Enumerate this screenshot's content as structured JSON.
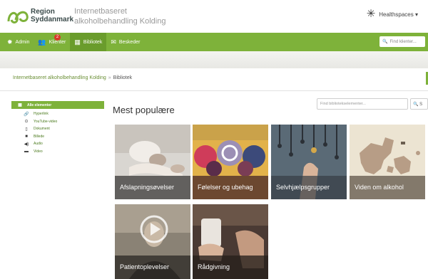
{
  "header": {
    "logo_line1": "Region",
    "logo_line2": "Syddanmark",
    "title_line1": "Internetbaseret",
    "title_line2": "alkoholbehandling Kolding",
    "user_menu": "Healthspaces ▾"
  },
  "nav": {
    "items": [
      {
        "label": "Admin",
        "icon": "gear-icon"
      },
      {
        "label": "Klienter",
        "icon": "users-icon",
        "badge": "2"
      },
      {
        "label": "Bibliotek",
        "icon": "grid-icon"
      },
      {
        "label": "Beskeder",
        "icon": "envelope-icon"
      }
    ],
    "search_placeholder": "Find klienter..."
  },
  "breadcrumb": {
    "root": "Internetbaseret alkoholbehandling Kolding",
    "separator": "»",
    "current": "Bibliotek"
  },
  "sidebar": {
    "items": [
      {
        "label": "Alle elementer",
        "icon": "grid-icon"
      },
      {
        "label": "Hyperlink",
        "icon": "link-icon"
      },
      {
        "label": "YouTube-video",
        "icon": "play-icon"
      },
      {
        "label": "Dokument",
        "icon": "document-icon"
      },
      {
        "label": "Billede",
        "icon": "camera-icon"
      },
      {
        "label": "Audio",
        "icon": "speaker-icon"
      },
      {
        "label": "Video",
        "icon": "video-icon"
      }
    ]
  },
  "main": {
    "heading": "Mest populære",
    "search_placeholder": "Find bibliotekselementer...",
    "search_button": "S",
    "tiles": [
      {
        "label": "Afslapningsøvelser"
      },
      {
        "label": "Følelser og ubehag"
      },
      {
        "label": "Selvhjælpsgrupper"
      },
      {
        "label": "Viden om alkohol"
      },
      {
        "label": "Patientoplevelser"
      },
      {
        "label": "Rådgivning"
      }
    ]
  },
  "colors": {
    "brand_green": "#7eb23a",
    "link_green": "#4b7a1e"
  }
}
